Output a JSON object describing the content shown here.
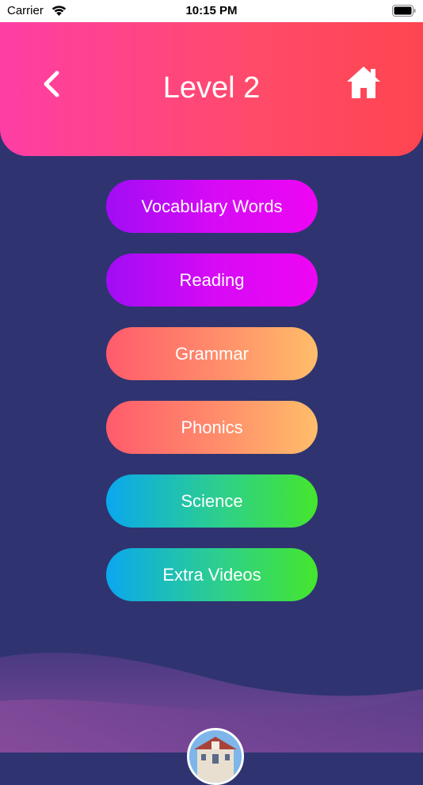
{
  "status_bar": {
    "carrier": "Carrier",
    "time": "10:15 PM",
    "wifi_icon": "wifi-icon",
    "battery_icon": "battery-icon"
  },
  "header": {
    "title": "Level 2",
    "back_icon": "chevron-left-icon",
    "home_icon": "home-icon",
    "colors": {
      "start": "#ff3ea5",
      "end": "#ff4550"
    }
  },
  "menu": {
    "items": [
      {
        "label": "Vocabulary Words",
        "style": "purple"
      },
      {
        "label": "Reading",
        "style": "purple"
      },
      {
        "label": "Grammar",
        "style": "orange"
      },
      {
        "label": "Phonics",
        "style": "orange"
      },
      {
        "label": "Science",
        "style": "green"
      },
      {
        "label": "Extra Videos",
        "style": "green"
      }
    ]
  },
  "background_color": "#2f3470",
  "footer": {
    "avatar_icon": "school-building-avatar"
  }
}
